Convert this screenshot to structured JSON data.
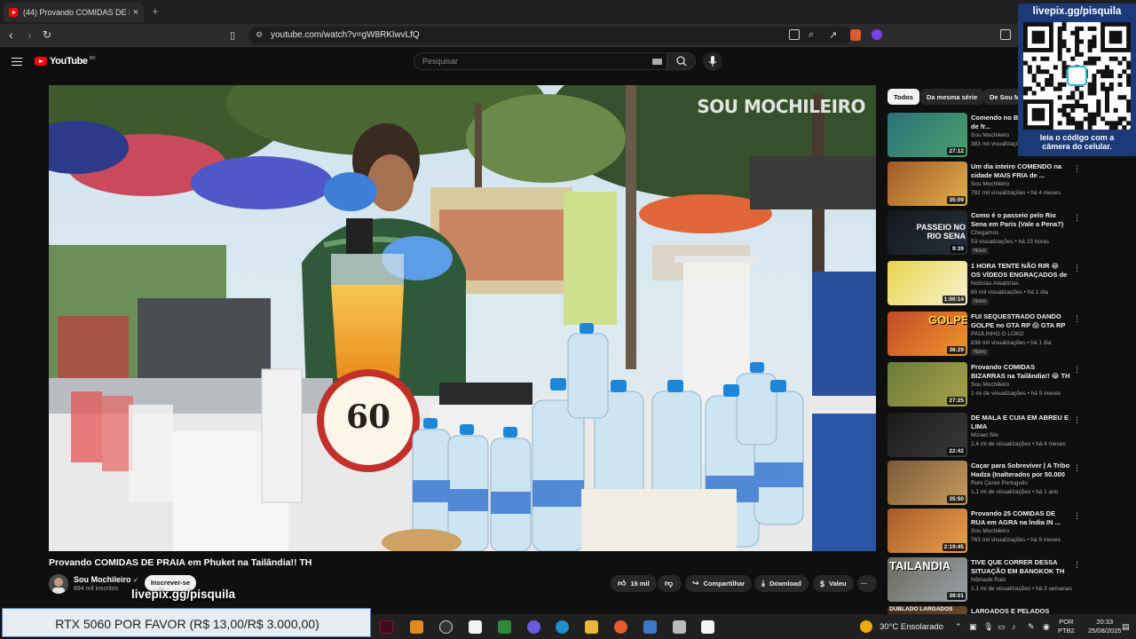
{
  "browser": {
    "tab_title": "(44) Provando COMIDAS DE P",
    "tab_close": "×",
    "new_tab": "+",
    "url": "youtube.com/watch?v=gW8RKlwvLfQ"
  },
  "youtube": {
    "logo_text": "YouTube",
    "logo_region": "BR",
    "search_placeholder": "Pesquisar",
    "chips": [
      "Todos",
      "Da mesma série",
      "De Sou M"
    ]
  },
  "video": {
    "watermark": "SOU MOCHILEIRO",
    "price_sign": "60",
    "title": "Provando COMIDAS DE PRAIA em Phuket na Tailândia!! TH",
    "channel": "Sou Mochileiro",
    "subscribers": "894 mil inscritos",
    "subscribe_label": "Inscrever-se",
    "likes": "16 mil",
    "share_label": "Compartilhar",
    "download_label": "Download",
    "thanks_label": "Valeu",
    "more_label": "···"
  },
  "recommendations": [
    {
      "title": "Comendo no BIG MERCADO de fr...",
      "channel": "Sou Mochileiro",
      "meta": "383 mil visualizações",
      "duration": "27:12",
      "badge": ""
    },
    {
      "title": "Um dia inteiro COMENDO na cidade MAIS FRIA de ...",
      "channel": "Sou Mochileiro",
      "meta": "782 mil visualizações • há 4 meses",
      "duration": "35:09",
      "badge": ""
    },
    {
      "title": "Como é o passeio pelo Rio Sena em Paris (Vale a Pena?)",
      "channel": "Chegamos",
      "meta": "53 visualizações • há 23 horas",
      "duration": "9:39",
      "badge": "Novo"
    },
    {
      "title": "1 HORA TENTE NÃO RIR 😂 OS VÍDEOS ENGRAÇADOS de ...",
      "channel": "Notícias Aleatórias",
      "meta": "60 mil visualizações • há 1 dia",
      "duration": "1:00:14",
      "badge": "Novo"
    },
    {
      "title": "FUI SEQUESTRADO DANDO GOLPE no GTA RP 😱 GTA RP ...",
      "channel": "PAULINHO O LOKO",
      "meta": "838 mil visualizações • há 1 dia",
      "duration": "36:29",
      "badge": "Novo"
    },
    {
      "title": "Provando COMIDAS BIZARRAS na Tailândia!! 😂 TH",
      "channel": "Sou Mochileiro",
      "meta": "1 mi de visualizações • há 9 meses",
      "duration": "27:25",
      "badge": ""
    },
    {
      "title": "DE MALA E CUIA EM ABREU E LIMA",
      "channel": "Mizael Silv",
      "meta": "2,4 mi de visualizações • há 4 meses",
      "duration": "22:42",
      "badge": ""
    },
    {
      "title": "Caçar para Sobreviver | A Tribo Hadza (Inalterados por 50.000 ...",
      "channel": "Ruhi Çenet Português",
      "meta": "1,1 mi de visualizações • há 1 ano",
      "duration": "35:50",
      "badge": ""
    },
    {
      "title": "Provando 25 COMIDAS DE RUA em AGRA na Índia IN ...",
      "channel": "Sou Mochileiro",
      "meta": "763 mil visualizações • há 9 meses",
      "duration": "2:19:45",
      "badge": ""
    },
    {
      "title": "TIVE QUE CORRER DESSA SITUAÇÃO EM BANGKOK TH",
      "channel": "Nômade Raiz",
      "meta": "1,1 mi de visualizações • há 3 semanas",
      "duration": "39:01",
      "badge": ""
    },
    {
      "title": "LARGADOS E PELADOS",
      "channel": "",
      "meta": "",
      "duration": "",
      "badge": ""
    }
  ],
  "thumb_texts": [
    "TAILANDIA",
    "PASSEIO NO RIO SENA",
    "GOLPE",
    "DUBLADO LARGADOS"
  ],
  "overlay": {
    "livepix_link": "livepix.gg/pisquila",
    "qr_caption_1": "leia o código com a",
    "qr_caption_2": "câmera do celular.",
    "livepix_bottom": "livepix.gg/pisquila",
    "goal_text": "RTX 5060 POR FAVOR (R$ 13,00/R$ 3.000,00)"
  },
  "taskbar": {
    "weather": "30°C  Ensolarado",
    "lang_1": "POR",
    "lang_2": "PTB2",
    "time": "20:33",
    "date": "25/08/2025"
  },
  "colors": {
    "youtube_red": "#ff0000",
    "qr_panel": "#1a3a78",
    "goal_border": "#3a86c8"
  }
}
